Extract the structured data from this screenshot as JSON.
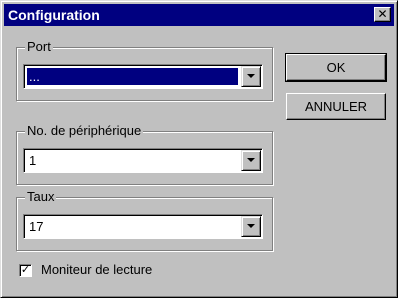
{
  "window": {
    "title": "Configuration",
    "close_glyph": "✕"
  },
  "groups": {
    "port": {
      "label": "Port",
      "value": "..."
    },
    "device": {
      "label": "No. de périphérique",
      "value": "1"
    },
    "rate": {
      "label": "Taux",
      "value": "17"
    }
  },
  "buttons": {
    "ok": "OK",
    "cancel": "ANNULER"
  },
  "checkbox": {
    "label": "Moniteur de lecture",
    "checked_glyph": "✓",
    "checked": true
  },
  "colors": {
    "title_bar": "#000080",
    "dialog_face": "#c0c0c0",
    "selection": "#000080"
  },
  "icons": [
    "close-icon",
    "chevron-down-icon",
    "checkmark-icon"
  ]
}
